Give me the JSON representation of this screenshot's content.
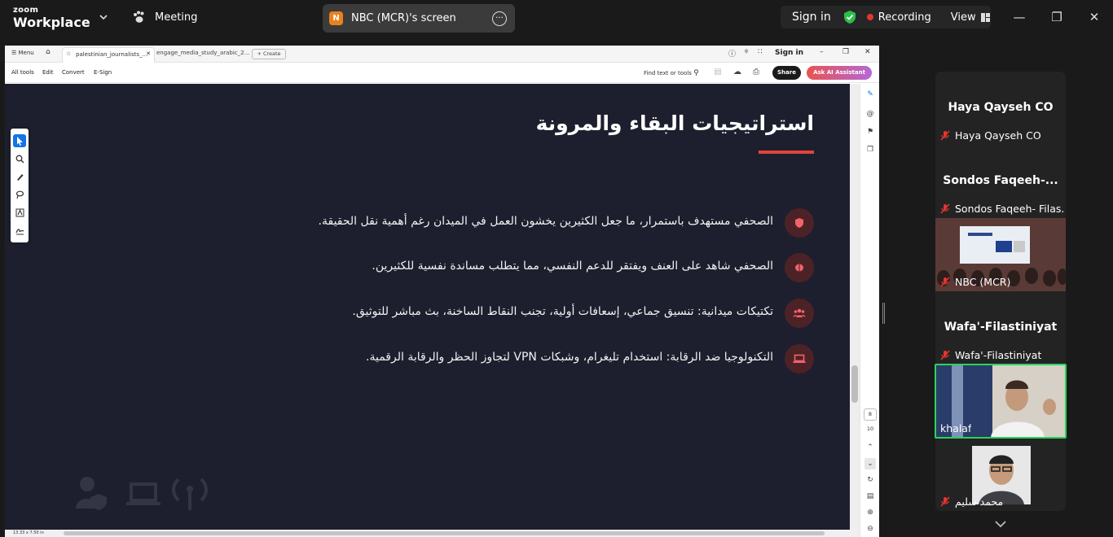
{
  "zoom": {
    "brand_top": "zoom",
    "brand_bottom": "Workplace",
    "meeting_label": "Meeting",
    "share_badge": "N",
    "share_title": "NBC (MCR)'s screen",
    "sign_in": "Sign in",
    "recording": "Recording",
    "view": "View",
    "accent_green": "#2bd45a",
    "recording_color": "#e5352f"
  },
  "viewer": {
    "menu": "Menu",
    "tab1": "palestinian_journalists_...",
    "tab2": "engage_media_study_arabic_2...",
    "create": "+ Create",
    "sign_in": "Sign in",
    "tools": [
      "All tools",
      "Edit",
      "Convert",
      "E-Sign"
    ],
    "find": "Find text or tools",
    "share": "Share",
    "ask_ai": "Ask AI Assistant",
    "page_current": "8",
    "page_total": "10",
    "page_size": "13.33 x 7.50 in"
  },
  "slide": {
    "title": "استراتيجيات البقاء والمرونة",
    "accent": "#e0453a",
    "bullets": [
      {
        "icon": "shield-icon",
        "text": "الصحفي مستهدف باستمرار، ما جعل الكثيرين يخشون العمل في الميدان رغم أهمية نقل الحقيقة."
      },
      {
        "icon": "brain-icon",
        "text": "الصحفي شاهد على العنف ويفتقر للدعم النفسي، مما يتطلب مساندة نفسية للكثيرين."
      },
      {
        "icon": "users-icon",
        "text": "تكتيكات ميدانية: تنسيق جماعي، إسعافات أولية، تجنب النقاط الساخنة، بث مباشر للتوثيق."
      },
      {
        "icon": "laptop-icon",
        "text": "التكنولوجيا ضد الرقابة: استخدام تليغرام، وشبكات VPN لتجاوز الحظر والرقابة الرقمية."
      }
    ]
  },
  "participants": [
    {
      "title": "Haya Qayseh CO",
      "name": "Haya Qayseh CO",
      "muted": true,
      "video": false
    },
    {
      "title": "Sondos  Faqeeh-...",
      "name": "Sondos Faqeeh- Filas...",
      "muted": true,
      "video": false
    },
    {
      "title": "",
      "name": "NBC (MCR)",
      "muted": true,
      "video": true
    },
    {
      "title": "Wafa'-Filastiniyat",
      "name": "Wafa'-Filastiniyat",
      "muted": true,
      "video": false
    },
    {
      "title": "",
      "name": "khalaf",
      "muted": false,
      "video": true,
      "active": true
    },
    {
      "title": "",
      "name": "محمد سليم",
      "muted": true,
      "video": true
    }
  ]
}
